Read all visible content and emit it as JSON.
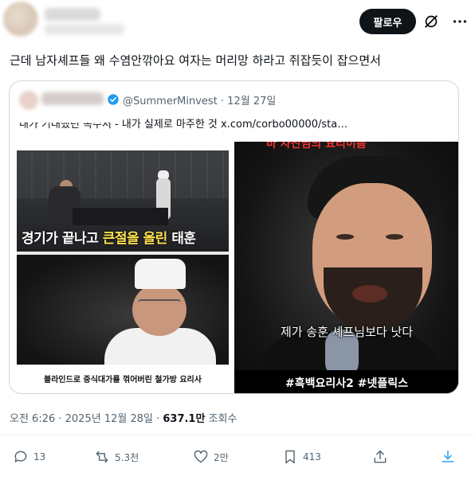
{
  "header": {
    "follow_label": "팔로우",
    "grok_icon": "grok-icon",
    "more_icon": "more-icon"
  },
  "tweet": {
    "text": "근데 남자셰프들 왜 수염안깎아요 여자는 머리망 하라고 쥐잡듯이 잡으면서"
  },
  "quote": {
    "handle_and_time": "@SummerMinvest · 12월 27일",
    "text": "내가 기대했던 복수저 - 내가 실제로 마주한 것  x.com/corbo00000/sta…",
    "left_top_caption_a": "경기가 끝나고 ",
    "left_top_caption_b": "큰절을 올린",
    "left_top_caption_c": " 태훈",
    "left_bottom_caption": "블라인드로 중식대가를 꺾어버린 철가방 요리사",
    "right_top_caption": "바 사진님의 요리이름",
    "right_caption": "제가 송훈 셰프님보다 낫다",
    "right_banner": "#흑백요리사2 #넷플릭스"
  },
  "meta": {
    "timestamp": "오전 6:26 · 2025년 12월 28일 · ",
    "views": "637.1만",
    "views_label": " 조회수"
  },
  "actions": {
    "replies": "13",
    "reposts": "5.3천",
    "likes": "2만",
    "bookmarks": "413"
  },
  "colors": {
    "accent_black": "#0f1419",
    "muted": "#536471",
    "verified_blue": "#1d9bf0",
    "border": "#cfd9de"
  }
}
